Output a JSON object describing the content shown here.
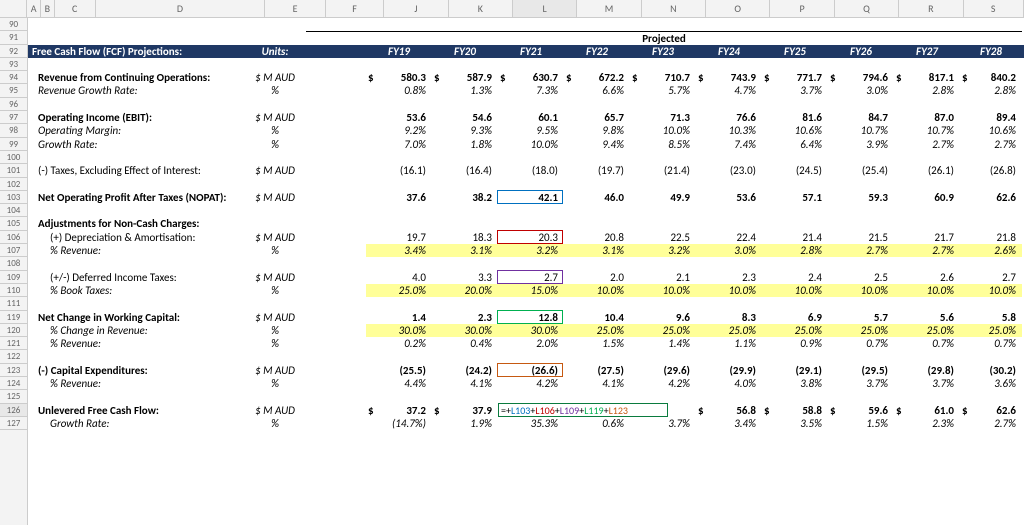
{
  "columns": [
    "A",
    "B",
    "C",
    "D",
    "E",
    "F",
    "J",
    "K",
    "L",
    "M",
    "N",
    "O",
    "P",
    "Q",
    "R",
    "S"
  ],
  "rowStart": 90,
  "rowEnd": 127,
  "activeCell": {
    "col": "L",
    "row": 126
  },
  "projectedLabel": "Projected",
  "header": {
    "title": "Free Cash Flow (FCF) Projections:",
    "unitsHeader": "Units:",
    "years": [
      "FY19",
      "FY20",
      "FY21",
      "FY22",
      "FY23",
      "FY24",
      "FY25",
      "FY26",
      "FY27",
      "FY28"
    ]
  },
  "lines": [
    {
      "row": 94,
      "label": "Revenue from Continuing Operations:",
      "units": "$ M AUD",
      "bold": true,
      "dollar": true,
      "vals": [
        "580.3",
        "587.9",
        "630.7",
        "672.2",
        "710.7",
        "743.9",
        "771.7",
        "794.6",
        "817.1",
        "840.2"
      ]
    },
    {
      "row": 95,
      "label": "Revenue Growth Rate:",
      "units": "%",
      "italic": true,
      "vals": [
        "0.8%",
        "1.3%",
        "7.3%",
        "6.6%",
        "5.7%",
        "4.7%",
        "3.7%",
        "3.0%",
        "2.8%",
        "2.8%"
      ]
    },
    {
      "row": 96,
      "blank": true
    },
    {
      "row": 97,
      "label": "Operating Income (EBIT):",
      "units": "$ M AUD",
      "bold": true,
      "vals": [
        "53.6",
        "54.6",
        "60.1",
        "65.7",
        "71.3",
        "76.6",
        "81.6",
        "84.7",
        "87.0",
        "89.4"
      ]
    },
    {
      "row": 98,
      "label": "Operating Margin:",
      "units": "%",
      "italic": true,
      "vals": [
        "9.2%",
        "9.3%",
        "9.5%",
        "9.8%",
        "10.0%",
        "10.3%",
        "10.6%",
        "10.7%",
        "10.7%",
        "10.6%"
      ]
    },
    {
      "row": 99,
      "label": "Growth Rate:",
      "units": "%",
      "italic": true,
      "vals": [
        "7.0%",
        "1.8%",
        "10.0%",
        "9.4%",
        "8.5%",
        "7.4%",
        "6.4%",
        "3.9%",
        "2.7%",
        "2.7%"
      ]
    },
    {
      "row": 100,
      "blank": true
    },
    {
      "row": 101,
      "label": "(-) Taxes, Excluding Effect of Interest:",
      "units": "$ M AUD",
      "vals": [
        "(16.1)",
        "(16.4)",
        "(18.0)",
        "(19.7)",
        "(21.4)",
        "(23.0)",
        "(24.5)",
        "(25.4)",
        "(26.1)",
        "(26.8)"
      ]
    },
    {
      "row": 102,
      "blank": true
    },
    {
      "row": 103,
      "label": "Net Operating Profit After Taxes (NOPAT):",
      "units": "$ M AUD",
      "bold": true,
      "vals": [
        "37.6",
        "38.2",
        "42.1",
        "46.0",
        "49.9",
        "53.6",
        "57.1",
        "59.3",
        "60.9",
        "62.6"
      ]
    },
    {
      "row": 104,
      "blank": true
    },
    {
      "row": 105,
      "label": "Adjustments for Non-Cash Charges:",
      "bold": true,
      "vals": []
    },
    {
      "row": 106,
      "label": "(+) Depreciation & Amortisation:",
      "units": "$ M AUD",
      "indent": 1,
      "vals": [
        "19.7",
        "18.3",
        "20.3",
        "20.8",
        "22.5",
        "22.4",
        "21.4",
        "21.5",
        "21.7",
        "21.8"
      ]
    },
    {
      "row": 107,
      "label": "% Revenue:",
      "units": "%",
      "italic": true,
      "indent": 1,
      "yellow": true,
      "vals": [
        "3.4%",
        "3.1%",
        "3.2%",
        "3.1%",
        "3.2%",
        "3.0%",
        "2.8%",
        "2.7%",
        "2.7%",
        "2.6%"
      ]
    },
    {
      "row": 108,
      "blank": true
    },
    {
      "row": 109,
      "label": "(+/-) Deferred Income Taxes:",
      "units": "$ M AUD",
      "indent": 1,
      "vals": [
        "4.0",
        "3.3",
        "2.7",
        "2.0",
        "2.1",
        "2.3",
        "2.4",
        "2.5",
        "2.6",
        "2.7"
      ]
    },
    {
      "row": 110,
      "label": "% Book Taxes:",
      "units": "%",
      "italic": true,
      "indent": 1,
      "yellow": true,
      "vals": [
        "25.0%",
        "20.0%",
        "15.0%",
        "10.0%",
        "10.0%",
        "10.0%",
        "10.0%",
        "10.0%",
        "10.0%",
        "10.0%"
      ]
    },
    {
      "row": 111,
      "blank": true
    },
    {
      "row": 119,
      "label": "Net Change in Working Capital:",
      "units": "$ M AUD",
      "bold": true,
      "vals": [
        "1.4",
        "2.3",
        "12.8",
        "10.4",
        "9.6",
        "8.3",
        "6.9",
        "5.7",
        "5.6",
        "5.8"
      ]
    },
    {
      "row": 120,
      "label": "% Change in Revenue:",
      "units": "%",
      "italic": true,
      "indent": 1,
      "yellow": true,
      "vals": [
        "30.0%",
        "30.0%",
        "30.0%",
        "25.0%",
        "25.0%",
        "25.0%",
        "25.0%",
        "25.0%",
        "25.0%",
        "25.0%"
      ]
    },
    {
      "row": 121,
      "label": "% Revenue:",
      "units": "%",
      "italic": true,
      "indent": 1,
      "vals": [
        "0.2%",
        "0.4%",
        "2.0%",
        "1.5%",
        "1.4%",
        "1.1%",
        "0.9%",
        "0.7%",
        "0.7%",
        "0.7%"
      ]
    },
    {
      "row": 122,
      "blank": true
    },
    {
      "row": 123,
      "label": "(-) Capital Expenditures:",
      "units": "$ M AUD",
      "bold": true,
      "vals": [
        "(25.5)",
        "(24.2)",
        "(26.6)",
        "(27.5)",
        "(29.6)",
        "(29.9)",
        "(29.1)",
        "(29.5)",
        "(29.8)",
        "(30.2)"
      ]
    },
    {
      "row": 124,
      "label": "% Revenue:",
      "units": "%",
      "italic": true,
      "indent": 1,
      "vals": [
        "4.4%",
        "4.1%",
        "4.2%",
        "4.1%",
        "4.2%",
        "4.0%",
        "3.8%",
        "3.7%",
        "3.7%",
        "3.6%"
      ]
    },
    {
      "row": 125,
      "blank": true
    },
    {
      "row": 126,
      "label": "Unlevered Free Cash Flow:",
      "units": "$ M AUD",
      "bold": true,
      "dollar": true,
      "vals": [
        "37.2",
        "37.9",
        "",
        "",
        "",
        "56.8",
        "58.8",
        "59.6",
        "61.0",
        "62.6"
      ]
    },
    {
      "row": 127,
      "label": "Growth Rate:",
      "units": "%",
      "italic": true,
      "indent": 1,
      "vals": [
        "(14.7%)",
        "1.9%",
        "35.3%",
        "0.6%",
        "3.7%",
        "3.4%",
        "3.5%",
        "1.5%",
        "2.3%",
        "2.7%"
      ]
    }
  ],
  "formula": {
    "text": "=+L103+L106+L109+L119+L123",
    "refs": [
      "L103",
      "L106",
      "L109",
      "L119",
      "L123"
    ]
  },
  "traceBoxes": [
    {
      "ref": "L103",
      "cls": "tb-blue"
    },
    {
      "ref": "L106",
      "cls": "tb-red"
    },
    {
      "ref": "L109",
      "cls": "tb-purple"
    },
    {
      "ref": "L119",
      "cls": "tb-green"
    },
    {
      "ref": "L123",
      "cls": "tb-orange"
    }
  ]
}
